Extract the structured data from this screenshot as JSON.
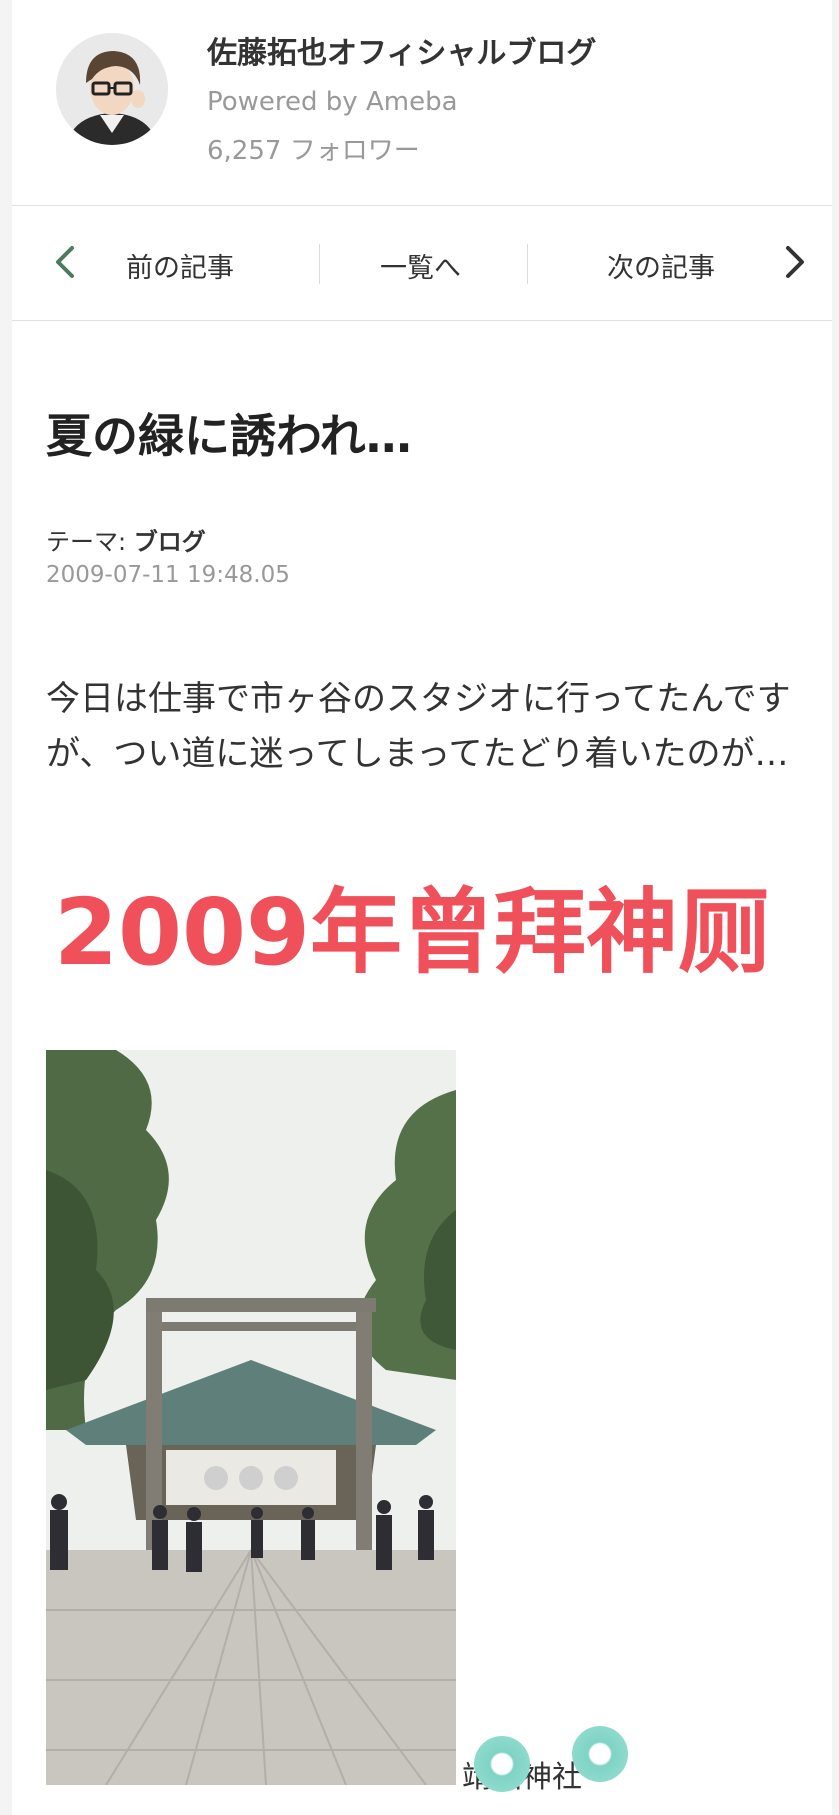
{
  "header": {
    "blog_title": "佐藤拓也オフィシャルブログ",
    "powered_by": "Powered by Ameba",
    "followers": "6,257 フォロワー"
  },
  "nav": {
    "prev_label": "前の記事",
    "list_label": "一覧へ",
    "next_label": "次の記事"
  },
  "article": {
    "title": "夏の緑に誘われ…",
    "theme_prefix": "テーマ:",
    "theme_value": "ブログ",
    "date": "2009-07-11 19:48.05",
    "body": "今日は仕事で市ヶ谷のスタジオに行ってたんですが、つい道に迷ってしまってたどり着いたのが…",
    "overlay_text": "2009年曾拜神厕",
    "photo_caption": "靖国神社"
  },
  "colors": {
    "overlay_red": "#f0505a",
    "nav_arrow": "#4c7a5e",
    "sticker_teal": "#7fd3c4"
  },
  "icons": {
    "prev": "chevron-left-icon",
    "next": "chevron-right-icon"
  }
}
